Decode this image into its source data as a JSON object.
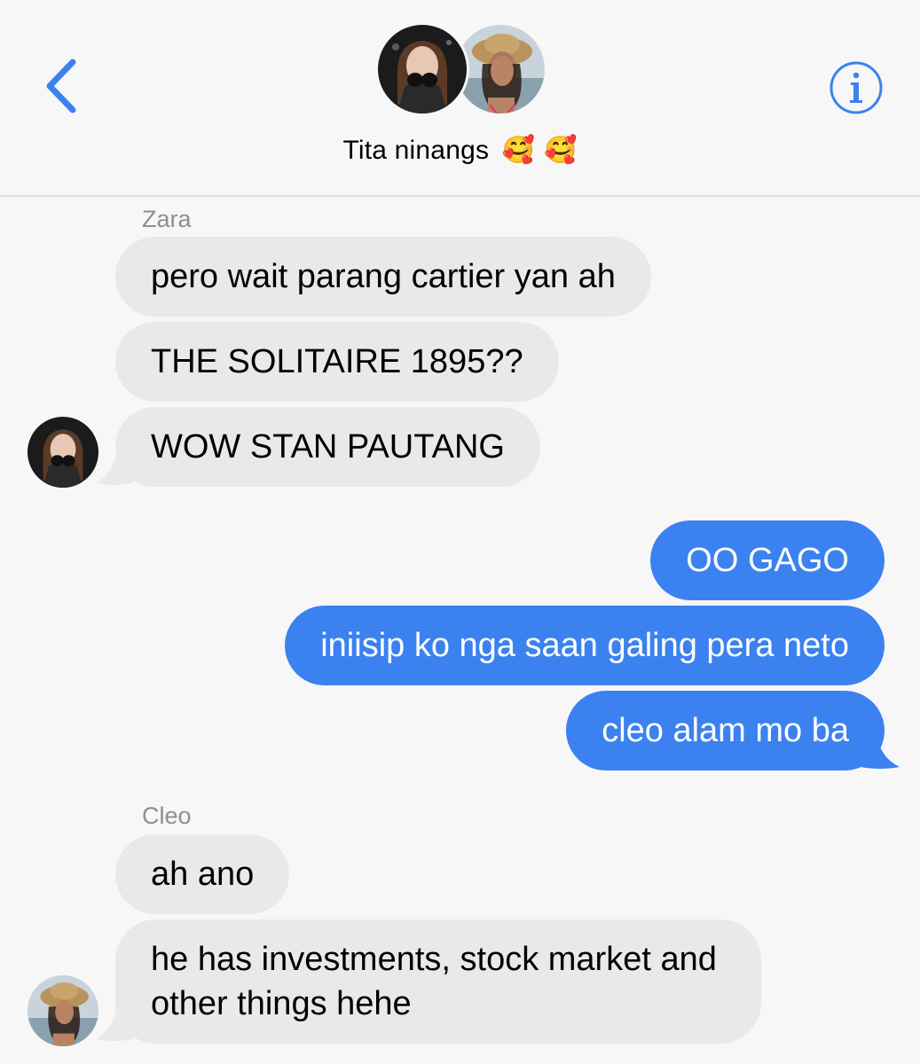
{
  "header": {
    "group_name": "Tita ninangs",
    "group_emoji": "🥰 🥰",
    "back_icon": "chevron-left-icon",
    "info_icon": "info-icon",
    "accent": "#3b82f0"
  },
  "messages": [
    {
      "group": "zara",
      "sender": "Zara",
      "bubbles": [
        "pero wait parang cartier yan ah",
        "THE SOLITAIRE 1895??",
        "WOW STAN PAUTANG"
      ]
    },
    {
      "group": "me",
      "bubbles": [
        "OO GAGO",
        "iniisip ko nga saan galing pera neto",
        "cleo alam mo ba"
      ]
    },
    {
      "group": "cleo",
      "sender": "Cleo",
      "bubbles": [
        "ah ano",
        "he has investments, stock market and other things hehe"
      ]
    }
  ],
  "colors": {
    "incoming_bubble": "#e9e9eb",
    "outgoing_bubble": "#3b82f0",
    "sender_label": "#8e8e93",
    "background": "#f7f7f8"
  }
}
